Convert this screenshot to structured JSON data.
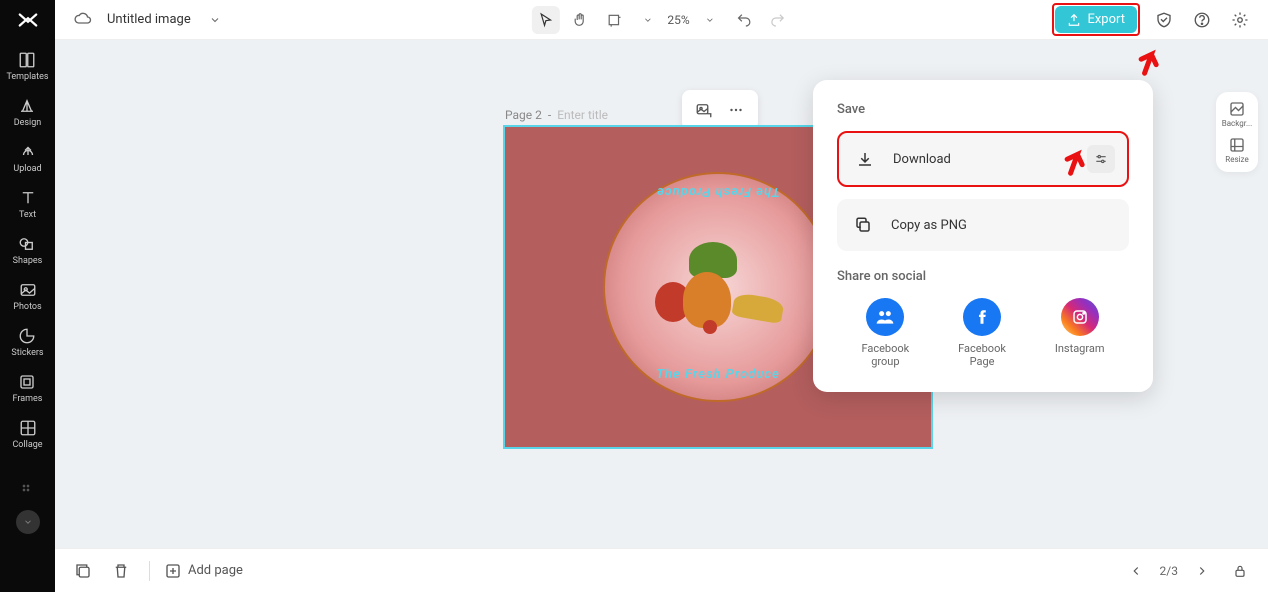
{
  "header": {
    "doc_title": "Untitled image",
    "zoom": "25%",
    "export_label": "Export"
  },
  "sidebar": {
    "items": [
      {
        "label": "Templates"
      },
      {
        "label": "Design"
      },
      {
        "label": "Upload"
      },
      {
        "label": "Text"
      },
      {
        "label": "Shapes"
      },
      {
        "label": "Photos"
      },
      {
        "label": "Stickers"
      },
      {
        "label": "Frames"
      },
      {
        "label": "Collage"
      }
    ]
  },
  "right_panel": {
    "items": [
      {
        "label": "Backgr..."
      },
      {
        "label": "Resize"
      }
    ]
  },
  "canvas": {
    "page_label": "Page 2",
    "title_placeholder": "Enter title",
    "badge_text_top": "The Fresh Produce",
    "badge_text_bottom": "The Fresh Produce"
  },
  "popover": {
    "save_heading": "Save",
    "download_label": "Download",
    "copy_png_label": "Copy as PNG",
    "share_heading": "Share on social",
    "social": [
      {
        "label": "Facebook\ngroup"
      },
      {
        "label": "Facebook\nPage"
      },
      {
        "label": "Instagram"
      }
    ]
  },
  "bottom": {
    "add_page": "Add page",
    "page_indicator": "2/3"
  }
}
